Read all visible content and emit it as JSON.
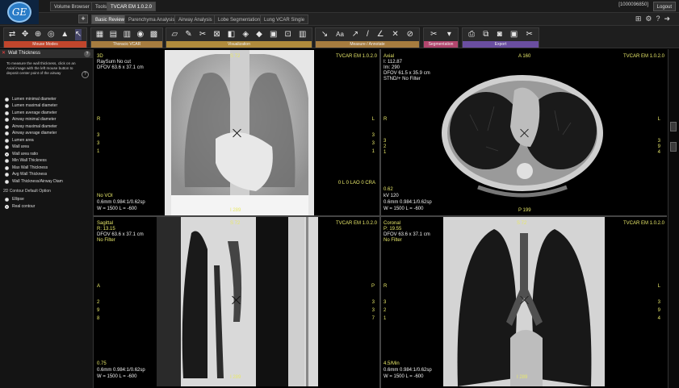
{
  "topbar": {
    "tabs": [
      {
        "label": "Volume Browser",
        "active": false
      },
      {
        "label": "Tools",
        "active": false
      },
      {
        "label": "TVCAR EM 1.0.2.0",
        "active": true
      }
    ],
    "study_id": "[1000096850]",
    "logout_label": "Logout"
  },
  "protocol_tabs": [
    {
      "label": "Basic Review",
      "active": true
    },
    {
      "label": "Parenchyma Analysis",
      "active": false
    },
    {
      "label": "Airway Analysis",
      "active": false
    },
    {
      "label": "Lobe Segmentation",
      "active": false
    },
    {
      "label": "Lung VCAR Single",
      "active": false
    }
  ],
  "toolbar_groups": [
    {
      "name": "Mouse Modes",
      "icons": [
        "⇄",
        "✥",
        "🔍",
        "◎",
        "▲",
        "↖"
      ]
    },
    {
      "name": "Thoracic VCAR",
      "icons": [
        "▦",
        "▤",
        "▥",
        "◉",
        "▩"
      ]
    },
    {
      "name": "Visualization",
      "icons": [
        "▱",
        "✎",
        "✂",
        "⊠",
        "◧",
        "◈",
        "◆",
        "▣",
        "⊡",
        "▥"
      ]
    },
    {
      "name": "Measure / Annotate",
      "icons": [
        "↘",
        "Aa",
        "↗",
        "/",
        "∠",
        "✕",
        "⊘"
      ]
    },
    {
      "name": "Segmentation",
      "icons": [
        "✂",
        "▾"
      ]
    },
    {
      "name": "Export",
      "icons": [
        "⎙",
        "⧉",
        "📷",
        "▣",
        "✂"
      ]
    }
  ],
  "left_panel": {
    "title": "Wall Thickness",
    "instructions": "To measure the wall thickness, click on an Axial image with the left mouse button to deposit center point of the airway",
    "options": [
      {
        "label": "Lumen minimal diameter",
        "selected": false
      },
      {
        "label": "Lumen maximal diameter",
        "selected": false
      },
      {
        "label": "Lumen average diameter",
        "selected": false
      },
      {
        "label": "Airway minimal diameter",
        "selected": false
      },
      {
        "label": "Airway maximal diameter",
        "selected": false
      },
      {
        "label": "Airway average diameter",
        "selected": false
      },
      {
        "label": "Lumen area",
        "selected": false
      },
      {
        "label": "Wall area",
        "selected": false
      },
      {
        "label": "Wall area ratio",
        "selected": true
      },
      {
        "label": "Min Wall Thickness",
        "selected": false
      },
      {
        "label": "Max Wall Thickness",
        "selected": false
      },
      {
        "label": "Avg Wall Thickness",
        "selected": false
      },
      {
        "label": "Wall Thickness/Airway Diam",
        "selected": false
      }
    ],
    "contour_section": "2D Contour Default Option",
    "contour_options": [
      {
        "label": "Ellipse",
        "selected": false
      },
      {
        "label": "Real contour",
        "selected": true
      }
    ]
  },
  "viewports": {
    "view3d": {
      "title": "3D",
      "line2": "RaySum No cut",
      "line3": "DFOV 63.6 x 37.1 cm",
      "app": "TVCAR EM 1.0.2.0",
      "top_orient": "S 72",
      "bottom_orient": "I 289",
      "left_orient": "R",
      "right_orient": "L",
      "left_nums": [
        "3",
        "3",
        "1"
      ],
      "right_nums": [
        "3",
        "3",
        "1"
      ],
      "angle": "0 L 0 LAO 0 CRA",
      "bottom1": "No VOI",
      "bottom2": "0.6mm 0.984:1/0.62sp",
      "bottom3": "W = 1500 L = -600"
    },
    "axial": {
      "title": "Axial",
      "line2": "I: 112.87",
      "line3": "Im: 290",
      "line4": "DFOV 61.5 x 35.9 cm",
      "line5": "STND/+ No Filter",
      "app": "TVCAR EM 1.0.2.0",
      "top_orient": "A 160",
      "bottom_orient": "P 199",
      "left_orient": "R",
      "right_orient": "L",
      "left_nums": [
        "3",
        "2",
        "1"
      ],
      "right_nums": [
        "3",
        "9",
        "4"
      ],
      "bottom0": "0.62",
      "bottom1": "kV 120",
      "bottom2": "0.6mm 0.984:1/0.62sp",
      "bottom3": "W = 1500 L = -600"
    },
    "sagittal": {
      "title": "Sagittal",
      "line2": "R: 13.15",
      "line3": "DFOV 63.6 x 37.1 cm",
      "line4": "No Filter",
      "app": "TVCAR EM 1.0.2.0",
      "top_orient": "S 72",
      "bottom_orient": "I 289",
      "left_orient": "A",
      "right_orient": "P",
      "left_nums": [
        "2",
        "9",
        "8"
      ],
      "right_nums": [
        "3",
        "3",
        "7"
      ],
      "bottom0": "0.75",
      "bottom2": "0.6mm 0.984:1/0.62sp",
      "bottom3": "W = 1500 L = -600"
    },
    "coronal": {
      "title": "Coronal",
      "line2": "P: 19.55",
      "line3": "DFOV 63.6 x 37.1 cm",
      "line4": "No Filter",
      "app": "TVCAR EM 1.0.2.0",
      "top_orient": "S 72",
      "bottom_orient": "I 289",
      "left_orient": "R",
      "right_orient": "L",
      "left_nums": [
        "3",
        "2",
        "1"
      ],
      "right_nums": [
        "3",
        "9",
        "4"
      ],
      "bottom0": "4.5/Min",
      "bottom2": "0.6mm 0.984:1/0.62sp",
      "bottom3": "W = 1500 L = -600"
    }
  }
}
